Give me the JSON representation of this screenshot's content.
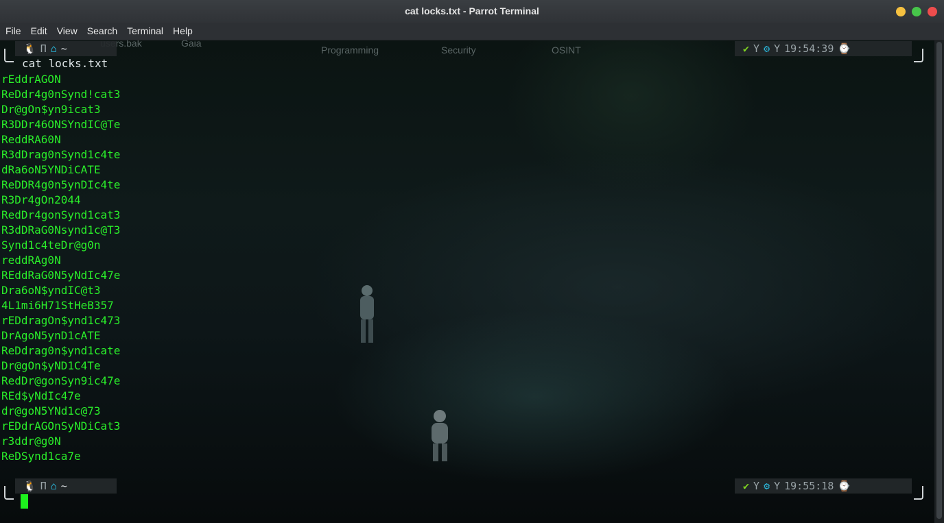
{
  "window": {
    "title": "cat locks.txt - Parrot Terminal",
    "colors": {
      "close": "#ee4d4d",
      "minimize": "#f6c140",
      "maximize": "#47c54a"
    }
  },
  "menu": {
    "items": [
      "File",
      "Edit",
      "View",
      "Search",
      "Terminal",
      "Help"
    ]
  },
  "desktop_labels": {
    "users_bak": "users.bak",
    "gaia": "Gaia",
    "programming": "Programming",
    "security": "Security",
    "osint": "OSINT"
  },
  "prompt": {
    "left_icons": [
      "linux-penguin-icon",
      "pi-icon",
      "home-icon"
    ],
    "pi": "Π",
    "dir": "~",
    "right_icons": [
      "check-icon",
      "fork-icon",
      "gear-icon",
      "clock-icon"
    ],
    "fork": "Y",
    "time1": "19:54:39",
    "time2": "19:55:18"
  },
  "command": "cat locks.txt",
  "output": [
    "rEddrAGON",
    "ReDdr4g0nSynd!cat3",
    "Dr@gOn$yn9icat3",
    "R3DDr46ONSYndIC@Te",
    "ReddRA60N",
    "R3dDrag0nSynd1c4te",
    "dRa6oN5YNDiCATE",
    "ReDDR4g0n5ynDIc4te",
    "R3Dr4gOn2044",
    "RedDr4gonSynd1cat3",
    "R3dDRaG0Nsynd1c@T3",
    "Synd1c4teDr@g0n",
    "reddRAg0N",
    "REddRaG0N5yNdIc47e",
    "Dra6oN$yndIC@t3",
    "4L1mi6H71StHeB357",
    "rEDdragOn$ynd1c473",
    "DrAgoN5ynD1cATE",
    "ReDdrag0n$ynd1cate",
    "Dr@gOn$yND1C4Te",
    "RedDr@gonSyn9ic47e",
    "REd$yNdIc47e",
    "dr@goN5YNd1c@73",
    "rEDdrAGOnSyNDiCat3",
    "r3ddr@g0N",
    "ReDSynd1ca7e"
  ],
  "colors": {
    "output_text": "#2aee2a",
    "cursor": "#1df21d",
    "accent_icon": "#2ab3d6"
  }
}
